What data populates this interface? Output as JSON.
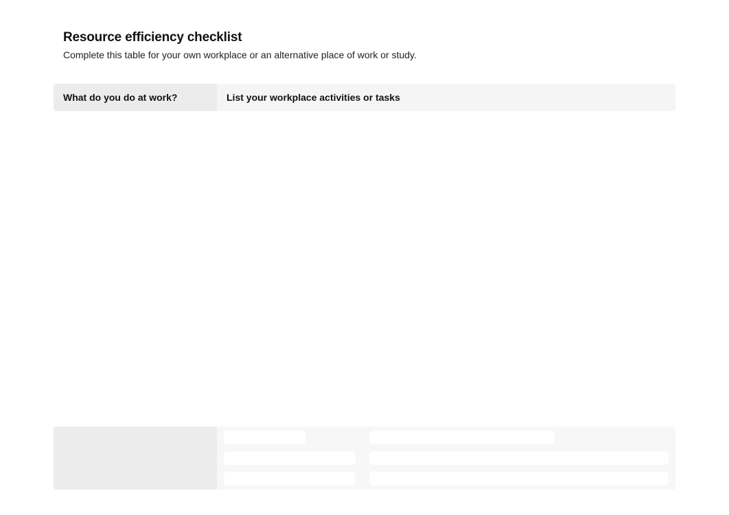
{
  "title": "Resource efficiency checklist",
  "subtitle": "Complete this table for your own workplace or an alternative place of work or study.",
  "table": {
    "header_left": "What do you do at work?",
    "header_right": "List your workplace activities or tasks"
  }
}
